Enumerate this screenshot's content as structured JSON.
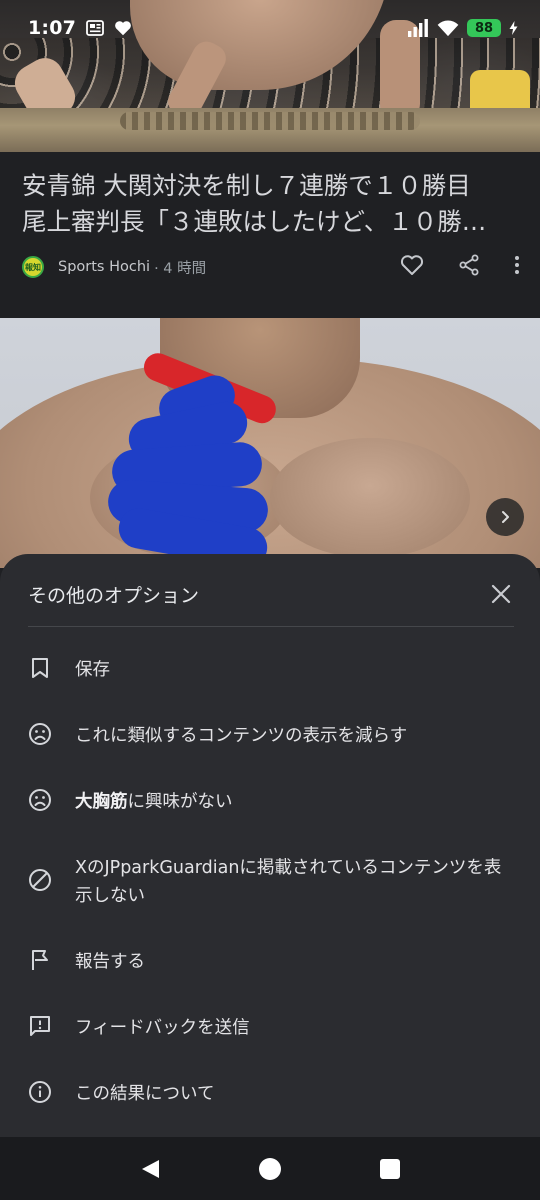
{
  "status_bar": {
    "time": "1:07",
    "battery": "88",
    "icons": [
      "news-notification-icon",
      "heart-icon",
      "signal-icon",
      "wifi-icon",
      "battery-icon"
    ]
  },
  "article": {
    "headline_line1": "安青錦 大関対決を制し７連勝で１０勝目",
    "headline_line2": "尾上審判長「３連敗はしたけど、１０勝…",
    "source_logo_text": "報知",
    "source_name": "Sports Hochi",
    "time_ago": " · 4 時間",
    "actions": [
      "heart-icon",
      "share-icon",
      "more-vert-icon"
    ]
  },
  "sheet": {
    "title": "その他のオプション",
    "options": [
      {
        "icon": "bookmark-icon",
        "label": "保存"
      },
      {
        "icon": "sad-face-icon",
        "label": "これに類似するコンテンツの表示を減らす"
      },
      {
        "icon": "sad-face-icon",
        "label_bold": "大胸筋",
        "label_rest": "に興味がない"
      },
      {
        "icon": "block-icon",
        "label": "XのJPparkGuardianに掲載されているコンテンツを表示しない"
      },
      {
        "icon": "flag-icon",
        "label": "報告する"
      },
      {
        "icon": "feedback-icon",
        "label": "フィードバックを送信"
      },
      {
        "icon": "info-icon",
        "label": "この結果について"
      }
    ]
  },
  "colors": {
    "sheet_bg": "#2b2c30",
    "page_bg": "#1f2023",
    "battery": "#34c759",
    "annotation_red": "#d8262a",
    "annotation_blue": "#1f3fc7"
  }
}
